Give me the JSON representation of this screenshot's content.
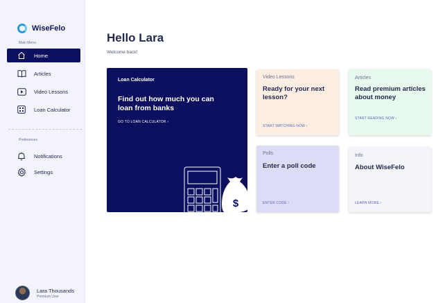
{
  "brand": {
    "name": "WiseFelo"
  },
  "sidebar": {
    "main_menu_label": "Main Menu",
    "items": [
      {
        "label": "Home",
        "icon": "home-icon",
        "active": true
      },
      {
        "label": "Articles",
        "icon": "book-icon"
      },
      {
        "label": "Video Lessons",
        "icon": "play-icon"
      },
      {
        "label": "Loan Calculator",
        "icon": "calculator-icon"
      }
    ],
    "preferences_label": "Preferences",
    "pref_items": [
      {
        "label": "Notifications",
        "icon": "bell-icon"
      },
      {
        "label": "Settings",
        "icon": "gear-icon"
      }
    ]
  },
  "user": {
    "name": "Lara Thousands",
    "role": "Premium User"
  },
  "main": {
    "greeting": "Hello Lara",
    "welcome": "Welcome back!"
  },
  "hero": {
    "label": "Loan Calculator",
    "title": "Find out how much you can loan from banks",
    "link": "GO TO LOAN CALCULATOR"
  },
  "cards": [
    {
      "category": "Video Lessons",
      "title": "Ready for your next lesson?",
      "link": "START WATCHING NOW",
      "color": "#fdeee3"
    },
    {
      "category": "Articles",
      "title": "Read premium articles about money",
      "link": "START READING NOW",
      "color": "#e8faee"
    },
    {
      "category": "Polls",
      "title": "Enter a poll code",
      "link": "ENTER CODE",
      "color": "#dcdcf7"
    },
    {
      "category": "Info",
      "title": "About WiseFelo",
      "link": "LEARN MORE",
      "color": "#f4f4fb"
    }
  ],
  "colors": {
    "primary": "#0b0f5e",
    "sidebar_bg": "#f2f3fb",
    "accent": "#2b9bd8"
  }
}
